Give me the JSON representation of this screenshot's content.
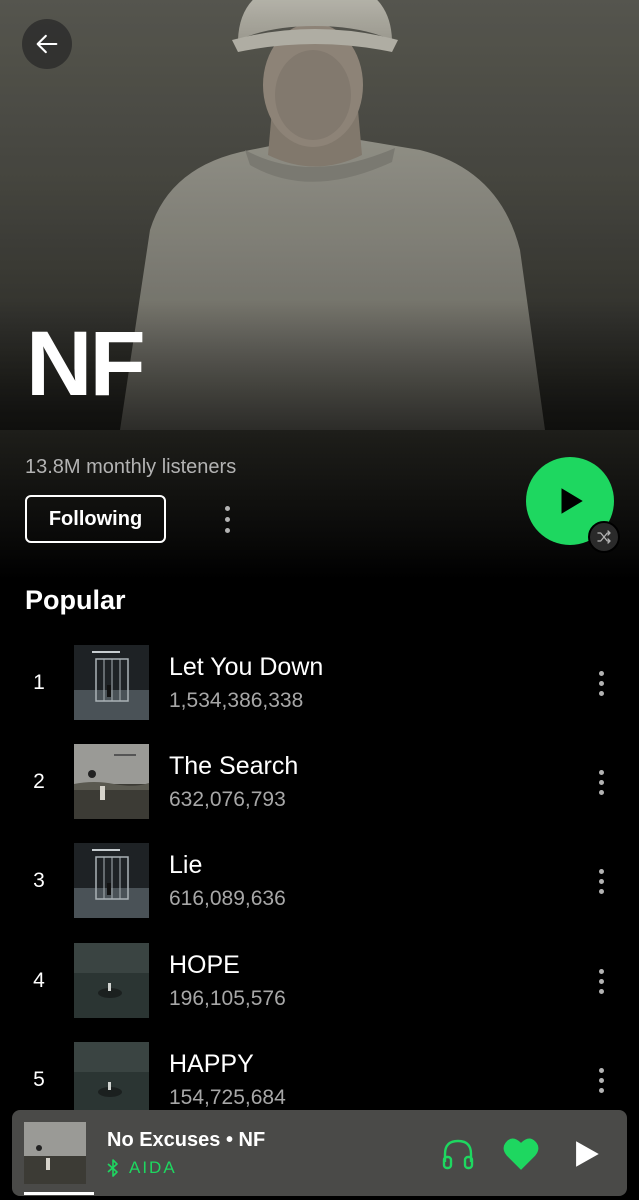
{
  "header": {
    "artist_name": "NF",
    "monthly_listeners": "13.8M monthly listeners",
    "follow_button_label": "Following"
  },
  "popular": {
    "title": "Popular",
    "tracks": [
      {
        "rank": "1",
        "title": "Let You Down",
        "plays": "1,534,386,338"
      },
      {
        "rank": "2",
        "title": "The Search",
        "plays": "632,076,793"
      },
      {
        "rank": "3",
        "title": "Lie",
        "plays": "616,089,636"
      },
      {
        "rank": "4",
        "title": "HOPE",
        "plays": "196,105,576"
      },
      {
        "rank": "5",
        "title": "HAPPY",
        "plays": "154,725,684"
      }
    ]
  },
  "now_playing": {
    "track": "No Excuses",
    "separator": "•",
    "artist": "NF",
    "title_line": "No Excuses • NF",
    "device": "AIDA",
    "liked": true,
    "progress": 0.1
  },
  "colors": {
    "accent_green": "#1ed760",
    "background": "#000000",
    "mini_player_bg": "#4a4a48",
    "secondary_text": "#a7a7a7"
  },
  "icons": {
    "back": "arrow-left-icon",
    "play": "play-icon",
    "shuffle": "shuffle-icon",
    "more": "more-vertical-icon",
    "bluetooth": "bluetooth-icon",
    "headphones": "headphones-icon",
    "heart": "heart-filled-icon"
  }
}
